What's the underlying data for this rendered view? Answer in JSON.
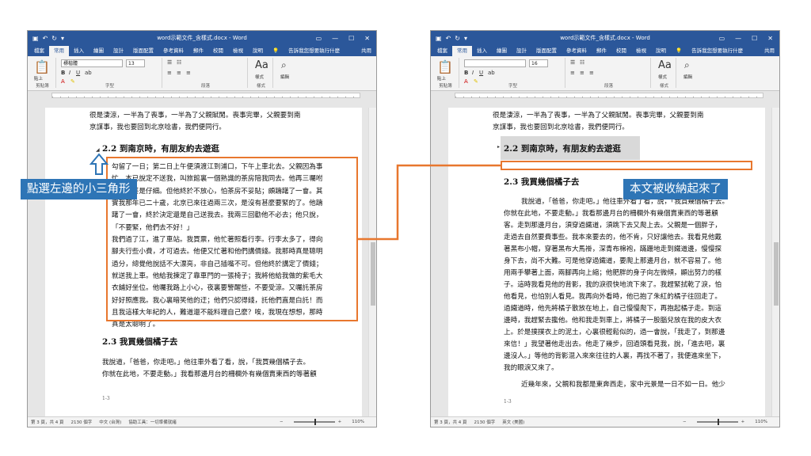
{
  "shared": {
    "window_title": "word示範文件_含樣式.docx - Word",
    "tabs": [
      "檔案",
      "常用",
      "插入",
      "繪圖",
      "設計",
      "版面配置",
      "參考資料",
      "郵件",
      "校閱",
      "檢視",
      "說明"
    ],
    "tell_me": "告訴我您想要執行什麼",
    "share": "共用",
    "group_labels": {
      "clipboard": "剪貼簿",
      "font": "字型",
      "paragraph": "段落",
      "styles": "樣式",
      "editing": "編輯"
    },
    "styles_label": "樣式",
    "editing_label": "編輯",
    "paste_label": "貼上",
    "footer_page": "1-3",
    "zoom": "110%"
  },
  "left": {
    "font_name": "標楷體",
    "font_size": "13",
    "heading_2_2": "2.2 到南京時，有朋友約去遊逛",
    "para1": [
      "勾留了一日；第二日上午便須渡江到浦口，下午上車北去。父親因為事",
      "忙，本已說定不送我，叫旅館裏一個熟識的茶房陪我同去。他再三囑咐",
      "茶房，甚是仔細。但他終於不放心，怕茶房不妥貼；頗躊躇了一會。其",
      "實我那年已二十歲，北京已來往過兩三次，是沒有甚麼要緊的了。他躊",
      "躇了一會，終於決定還是自己送我去。我兩三回勸他不必去；他只說，",
      "「不要緊，他們去不好！」"
    ],
    "para2": [
      "我們過了江，進了車站。我買票，他忙著照看行李。行李太多了，得向",
      "腳夫行些小費，才可過去。他便又忙著和他們講價錢。我那時真是聰明",
      "過分，總覺他說話不大漂亮，非自己插嘴不可。但他終於講定了價錢；",
      "就送我上車。他給我揀定了靠車門的一張椅子；我將他給我做的紫毛大",
      "衣鋪好坐位。他囑我路上小心，夜裏要警醒些，不要受涼。又囑託茶房",
      "好好照應我。我心裏暗笑他的迂；他們只認得錢，託他們直是白託！而",
      "且我這樣大年紀的人，難道還不能料理自己麼？唉，我現在想想，那時",
      "真是太聰明了。"
    ],
    "heading_2_3": "2.3 我買幾個橘子去",
    "para3": [
      "我說道，「爸爸，你走吧。」他往車外看了看，說，「我買幾個橘子去。",
      "你就在此地，不要走動。」我看那邊月台的柵欄外有幾個賣東西的等著顧"
    ],
    "status": [
      "第 3 頁，共 4 頁",
      "2130 個字",
      "中文 (台灣)",
      "協助工具：一切準備就緒"
    ]
  },
  "right": {
    "font_name": "",
    "font_size": "16",
    "heading_2_2": "2.2 到南京時，有朋友約去遊逛",
    "heading_2_3": "2.3 我買幾個橘子去",
    "para3": [
      "我說道，「爸爸，你走吧。」他往車外看了看，說，「我買幾個橘子去。",
      "你就在此地，不要走動。」我看那邊月台的柵欄外有幾個賣東西的等著顧",
      "客。走到那邊月台，須穿過鐵道，須跳下去又爬上去。父親是一個胖子，",
      "走過去自然要費事些。我本來要去的，他不肯，只好讓他去。我看見他戴",
      "著黑布小帽，穿著黑布大馬褂，深青布棉袍，蹣跚地走到鐵道邊，慢慢探",
      "身下去，尚不大難。可是他穿過鐵道，要爬上那邊月台，就不容易了。他",
      "用兩手攀著上面，兩腳再向上縮；他肥胖的身子向左微傾，顯出努力的樣",
      "子。這時我看見他的背影，我的淚很快地流下來了。我趕緊拭乾了淚，怕",
      "他看見，也怕別人看見。我再向外看時，他已抱了朱紅的橘子往回走了。",
      "過鐵道時，他先將橘子散放在地上，自己慢慢爬下，再抱起橘子走。到這",
      "邊時，我趕緊去攙他。他和我走到車上，將橘子一股腦兒放在我的皮大衣",
      "上。於是撲撲衣上的泥土，心裏很輕鬆似的，過一會說，「我走了，到那邊",
      "來信！」我望著他走出去。他走了幾步，回過頭看見我，說，「進去吧，裏",
      "邊沒人。」等他的背影混入來來往往的人裏，再找不著了，我便進來坐下，",
      "我的眼淚又來了。"
    ],
    "para4": "近幾年來，父親和我都是東奔西走，家中光景是一日不如一日。他少",
    "status": [
      "第 3 頁，共 4 頁",
      "2130 個字",
      "英文 (美國)"
    ]
  },
  "top_text": [
    "很是淒涼，一半為了喪事，一半為了父親賦閒。喪事完畢，父親要到南",
    "京謀事，我也要回到北京唸書，我們便同行。"
  ],
  "callouts": {
    "left": "點選左邊的小三角形",
    "right": "本文被收納起來了"
  },
  "colors": {
    "word_blue": "#2b579a",
    "callout_blue": "#2e75b6",
    "orange": "#e8772e"
  }
}
